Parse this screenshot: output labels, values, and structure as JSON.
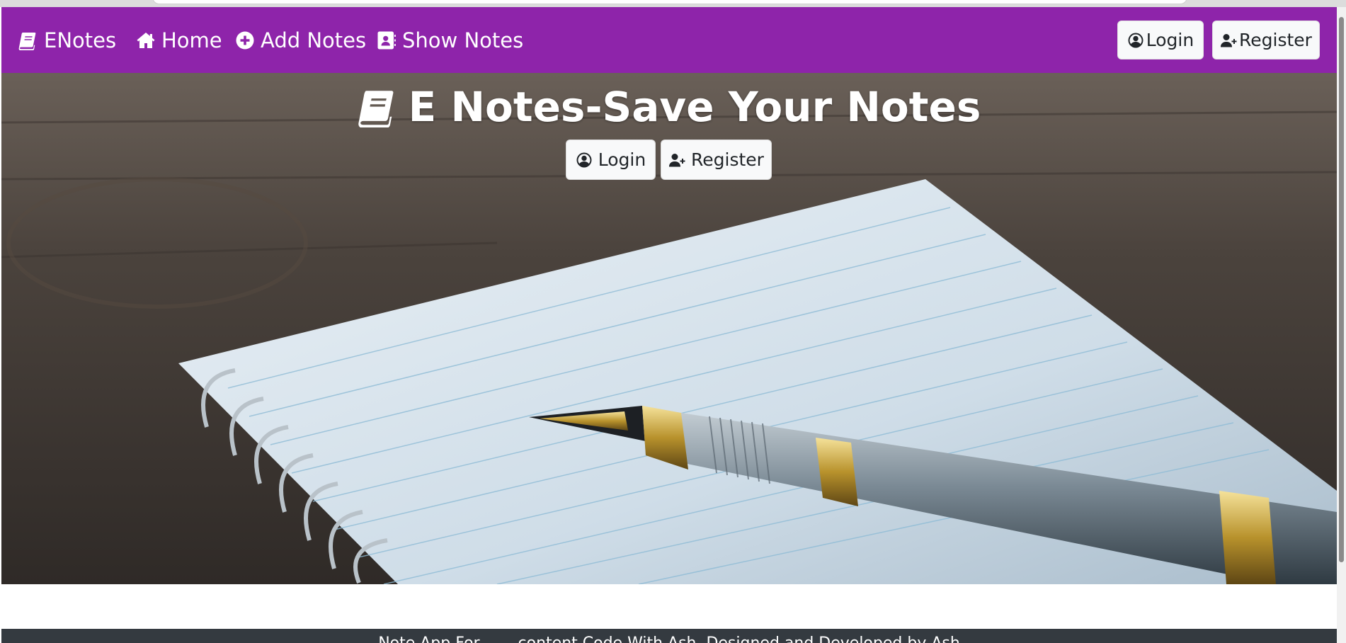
{
  "navbar": {
    "brand": "ENotes",
    "home": "Home",
    "add_notes": "Add Notes",
    "show_notes": "Show Notes",
    "login": "Login",
    "register": "Register",
    "color": "#8e24aa"
  },
  "hero": {
    "title": "E Notes-Save Your Notes",
    "login": "Login",
    "register": "Register"
  },
  "footer": {
    "text": "Note App For... ... content Code With Ash, Designed and Developed by Ash"
  },
  "icons": {
    "brand": "book-icon",
    "home": "home-icon",
    "add": "plus-circle-icon",
    "show": "address-book-icon",
    "login": "user-circle-icon",
    "register": "user-plus-icon"
  }
}
